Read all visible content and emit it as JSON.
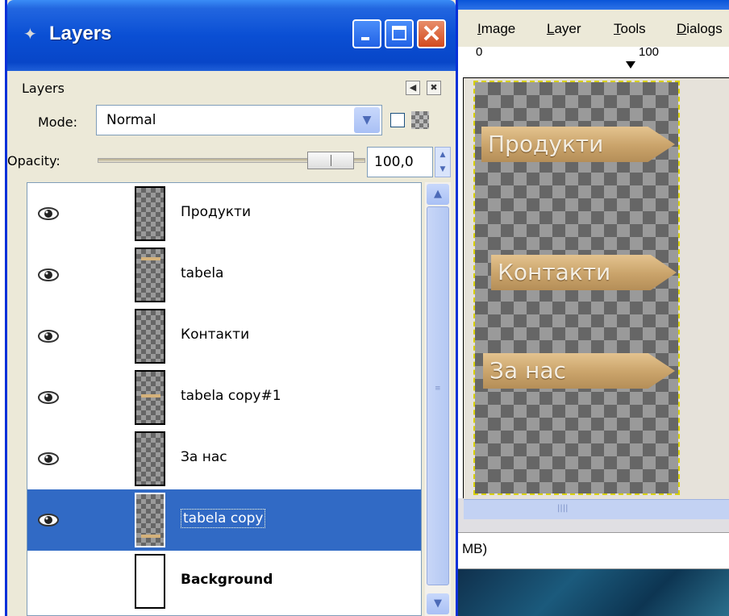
{
  "image_window": {
    "menu": [
      {
        "label": "Image",
        "accel": "I"
      },
      {
        "label": "Layer",
        "accel": "L"
      },
      {
        "label": "Tools",
        "accel": "T"
      },
      {
        "label": "Dialogs",
        "accel": "D"
      }
    ],
    "ruler_labels": [
      "0",
      "100"
    ],
    "canvas_signs": [
      "Продукти",
      "Контакти",
      "За нас"
    ],
    "status_text": "MB)"
  },
  "dialog": {
    "title": "Layers",
    "controls": {
      "minimize": "minimize-icon",
      "maximize": "maximize-icon",
      "close": "close-icon"
    },
    "tab_label": "Layers",
    "mode_label": "Mode:",
    "mode_value": "Normal",
    "opacity_label": "Opacity:",
    "opacity_value": "100,0",
    "opacity_level": 1.0,
    "layers": [
      {
        "name": "Продукти",
        "visible": true,
        "selected": false,
        "bold": false
      },
      {
        "name": "tabela",
        "visible": true,
        "selected": false,
        "bold": false
      },
      {
        "name": "Контакти",
        "visible": true,
        "selected": false,
        "bold": false
      },
      {
        "name": "tabela copy#1",
        "visible": true,
        "selected": false,
        "bold": false
      },
      {
        "name": "За нас",
        "visible": true,
        "selected": false,
        "bold": false
      },
      {
        "name": "tabela copy",
        "visible": true,
        "selected": true,
        "bold": false
      },
      {
        "name": "Background",
        "visible": false,
        "selected": false,
        "bold": true
      }
    ]
  },
  "colors": {
    "selection": "#316ac5",
    "titlebar": "#0a4fd4"
  }
}
